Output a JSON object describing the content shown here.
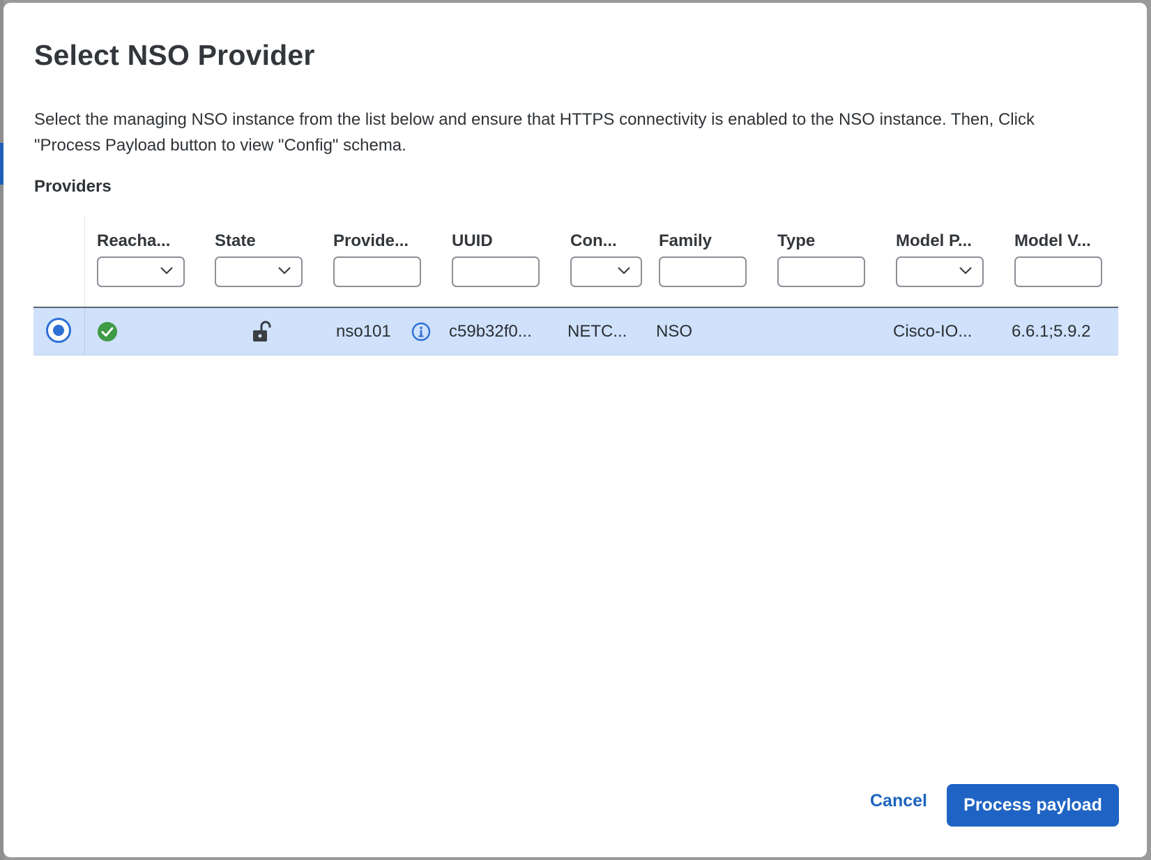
{
  "dialog": {
    "title": "Select NSO Provider",
    "description": "Select the managing NSO instance from the list below and ensure that HTTPS connectivity is enabled to the NSO instance. Then, Click \"Process Payload button to view \"Config\" schema.",
    "section_label": "Providers"
  },
  "table": {
    "columns": [
      {
        "label": "Reacha...",
        "filter": "dropdown"
      },
      {
        "label": "State",
        "filter": "dropdown"
      },
      {
        "label": "Provide...",
        "filter": "text"
      },
      {
        "label": "UUID",
        "filter": "text"
      },
      {
        "label": "Con...",
        "filter": "dropdown"
      },
      {
        "label": "Family",
        "filter": "text"
      },
      {
        "label": "Type",
        "filter": "text"
      },
      {
        "label": "Model P...",
        "filter": "dropdown"
      },
      {
        "label": "Model V...",
        "filter": "text"
      }
    ],
    "rows": [
      {
        "selected": true,
        "reachability_icon": "check-circle-icon",
        "state_icon": "unlock-icon",
        "provider": "nso101",
        "provider_info_icon": "info-icon",
        "uuid": "c59b32f0...",
        "connection": "NETC...",
        "family": "NSO",
        "type": "",
        "model_prefix": "Cisco-IO...",
        "model_version": "6.6.1;5.9.2"
      }
    ]
  },
  "footer": {
    "cancel_label": "Cancel",
    "primary_label": "Process payload"
  },
  "colors": {
    "accent": "#1f64c4",
    "row_selected": "#cfe1fb",
    "success": "#3e9a45"
  }
}
